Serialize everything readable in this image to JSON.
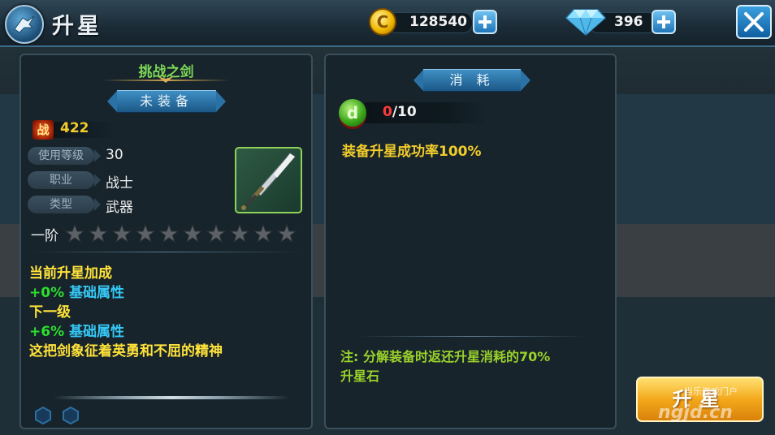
{
  "header": {
    "title": "升星",
    "gold_value": "128540",
    "gold_icon_glyph": "C",
    "diamond_value": "396"
  },
  "left_panel": {
    "item_name": "挑战之剑",
    "equip_status": "未装备",
    "power_icon_glyph": "战",
    "power_value": "422",
    "props": [
      {
        "label": "使用等级",
        "value": "30"
      },
      {
        "label": "职业",
        "value": "战士"
      },
      {
        "label": "类型",
        "value": "武器"
      }
    ],
    "tier_label": "一阶",
    "stars_total": 10,
    "stars_filled": 0,
    "current_bonus_title": "当前升星加成",
    "current_bonus_value": "+0%",
    "current_bonus_attr": "基础属性",
    "next_level_title": "下一级",
    "next_bonus_value": "+6%",
    "next_bonus_attr": "基础属性",
    "description": "这把剑象征着英勇和不屈的精神"
  },
  "right_panel": {
    "section_title": "消 耗",
    "stone_current": "0",
    "stone_required": "/10",
    "stone_icon_glyph": "d",
    "success_rate": "装备升星成功率100%",
    "note_line1": "注: 分解装备时返还升星消耗的70%",
    "note_line2": "升星石"
  },
  "upgrade_button_label": "升星",
  "watermark_text": "ngjd.cn",
  "watermark_top_text": "当乐游戏门户",
  "colors": {
    "accent_green": "#7ed957",
    "gold_text": "#f2cc2a",
    "bonus_green": "#2dde2d",
    "bonus_blue": "#36c8f5",
    "button_orange": "#f4a91c"
  }
}
